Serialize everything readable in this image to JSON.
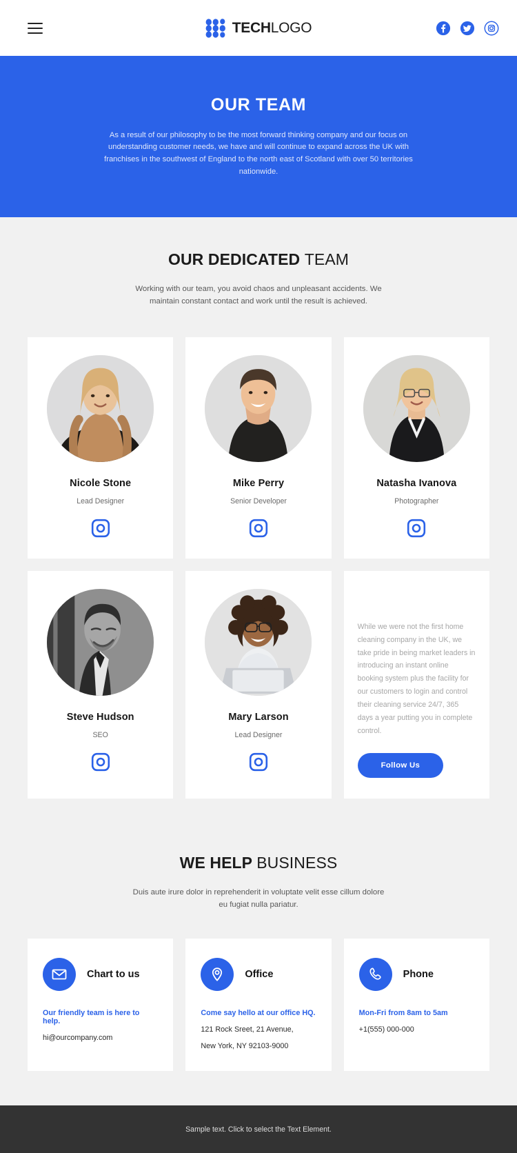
{
  "header": {
    "menu_icon": "hamburger-menu-icon",
    "logo": {
      "bold": "TECH",
      "light": "LOGO",
      "mark": "dot-grid-logo-icon"
    },
    "socials": [
      {
        "name": "facebook",
        "label": "Facebook"
      },
      {
        "name": "twitter",
        "label": "Twitter"
      },
      {
        "name": "instagram",
        "label": "Instagram"
      }
    ]
  },
  "hero": {
    "title": "OUR TEAM",
    "description": "As a result of our philosophy to be the most forward thinking company and our focus on understanding customer needs, we have and will continue to expand across the UK with franchises in the southwest of England to the north east of Scotland with over 50 territories nationwide.",
    "background_color": "#2b62e8"
  },
  "team_section": {
    "title_bold": "OUR DEDICATED",
    "title_light": "TEAM",
    "subtitle": "Working with our team, you avoid chaos and unpleasant accidents. We maintain constant contact and work until the result is achieved.",
    "members": [
      {
        "name": "Nicole Stone",
        "role": "Lead Designer",
        "social_icon": "instagram-icon"
      },
      {
        "name": "Mike Perry",
        "role": "Senior Developer",
        "social_icon": "instagram-icon"
      },
      {
        "name": "Natasha Ivanova",
        "role": "Photographer",
        "social_icon": "instagram-icon"
      },
      {
        "name": "Steve Hudson",
        "role": "SEO",
        "social_icon": "instagram-icon"
      },
      {
        "name": "Mary Larson",
        "role": "Lead Designer",
        "social_icon": "instagram-icon"
      }
    ],
    "text_card": {
      "body": "While we were not the first home cleaning company in the UK, we take pride in being market leaders in introducing an instant online booking system plus the facility for our customers to login and control their cleaning service 24/7, 365 days a year putting you in complete control.",
      "button_label": "Follow Us"
    }
  },
  "help_section": {
    "title_bold": "WE HELP",
    "title_light": "BUSINESS",
    "subtitle": "Duis aute irure dolor in reprehenderit in voluptate velit esse cillum dolore eu fugiat nulla pariatur.",
    "cards": [
      {
        "icon": "envelope-icon",
        "title": "Chart to us",
        "link": "Our friendly team is here to help.",
        "lines": [
          "hi@ourcompany.com"
        ]
      },
      {
        "icon": "map-pin-icon",
        "title": "Office",
        "link": "Come say hello at our office HQ.",
        "lines": [
          "121 Rock Sreet, 21 Avenue,",
          "New York, NY 92103-9000"
        ]
      },
      {
        "icon": "phone-icon",
        "title": "Phone",
        "link": "Mon-Fri from 8am to 5am",
        "lines": [
          "+1(555) 000-000"
        ]
      }
    ]
  },
  "footer": {
    "text": "Sample text. Click to select the Text Element.",
    "background_color": "#333333"
  },
  "colors": {
    "accent": "#2b62e8",
    "page_background": "#f1f1f1",
    "card_background": "#ffffff",
    "footer_background": "#333333"
  }
}
